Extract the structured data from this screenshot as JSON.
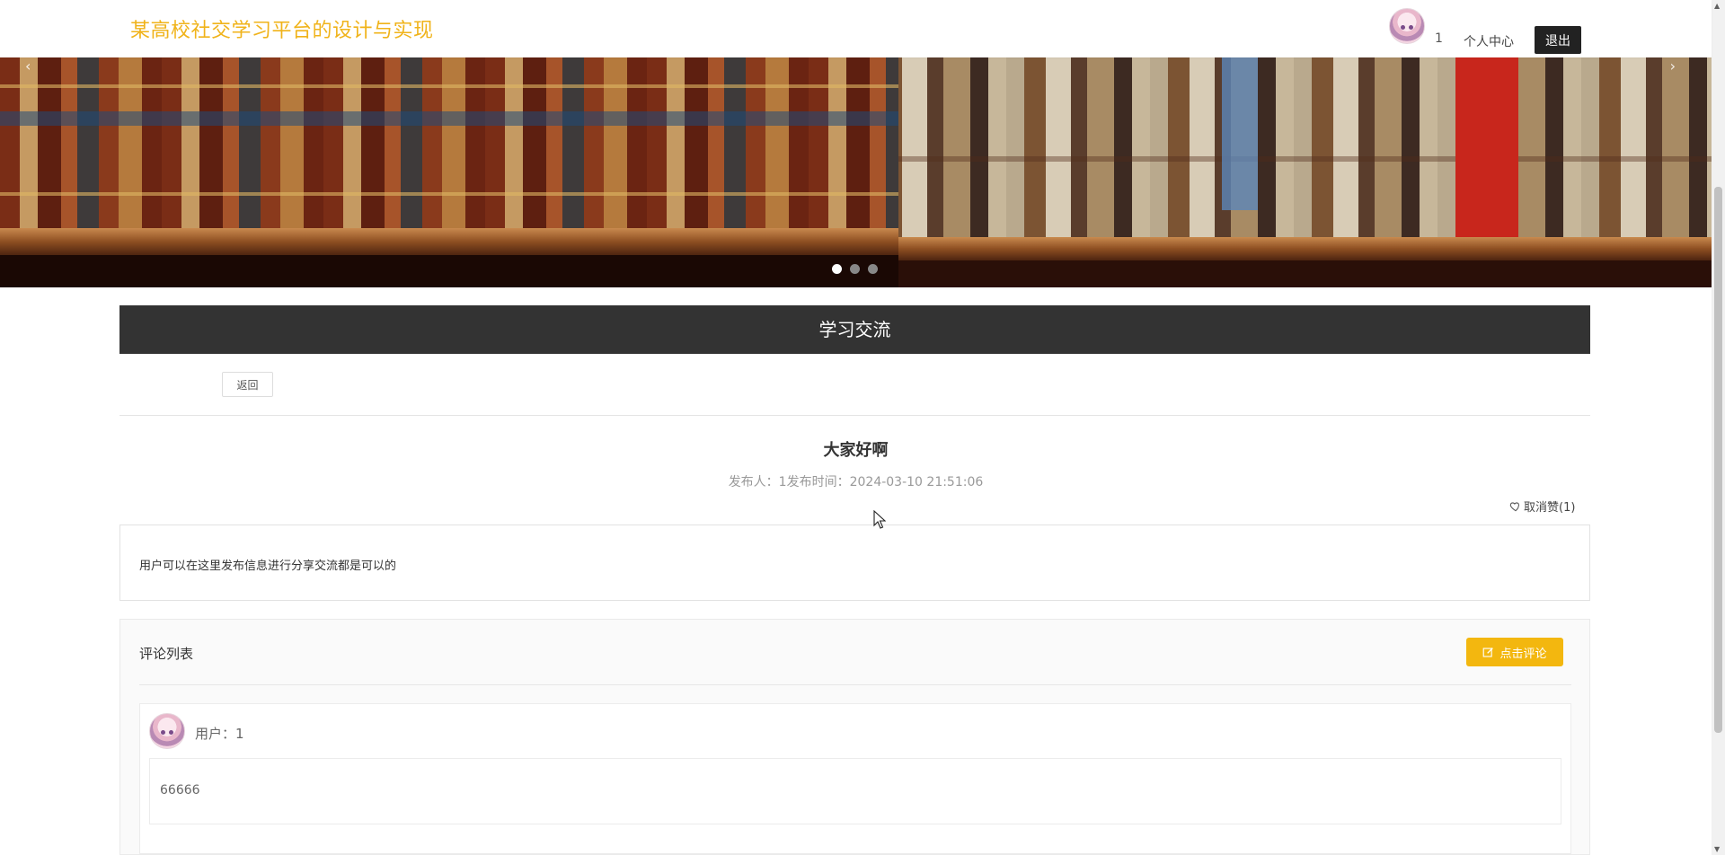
{
  "header": {
    "site_title": "某高校社交学习平台的设计与实现",
    "user_name": "1",
    "personal_center": "个人中心",
    "logout": "退出"
  },
  "banner": {
    "prev_arrow": "‹",
    "next_arrow": "›",
    "slide_count": 3,
    "active_slide": 1
  },
  "section": {
    "title": "学习交流",
    "back_label": "返回"
  },
  "post": {
    "title": "大家好啊",
    "meta": "发布人：1发布时间：2024-03-10 21:51:06",
    "like_label": "取消赞(1)",
    "content": "用户可以在这里发布信息进行分享交流都是可以的"
  },
  "comments": {
    "title": "评论列表",
    "add_label": "点击评论",
    "items": [
      {
        "user": "用户：1",
        "text": "66666"
      }
    ]
  },
  "colors": {
    "brand": "#f0b31a",
    "accent_button": "#f3b70f",
    "section_bar": "#333333",
    "logout_button": "#222222"
  },
  "icons": [
    "heart-icon",
    "edit-icon",
    "avatar",
    "chevron-left-icon",
    "chevron-right-icon"
  ]
}
